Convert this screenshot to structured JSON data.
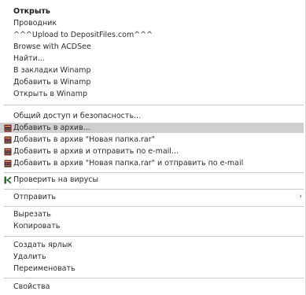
{
  "menu": {
    "open": "Открыть",
    "explorer": "Проводник",
    "upload": "^^^Upload to DepositFiles.com^^^",
    "browse_acdsee": "Browse with ACDSee",
    "find": "Найти...",
    "winamp_bookmarks": "В закладки Winamp",
    "winamp_add": "Добавить в Winamp",
    "winamp_open": "Открыть в Winamp",
    "sharing_security": "Общий доступ и безопасность...",
    "add_archive": "Добавить в архив...",
    "add_named_archive": "Добавить в архив \"Новая папка.rar\"",
    "add_archive_email": "Добавить в архив и отправить по e-mail...",
    "add_named_archive_email": "Добавить в архив \"Новая папка.rar\" и отправить по e-mail",
    "scan_viruses": "Проверить на вирусы",
    "send_to": "Отправить",
    "send_to_arrow": "›",
    "cut": "Вырезать",
    "copy": "Копировать",
    "create_shortcut": "Создать ярлык",
    "delete": "Удалить",
    "rename": "Переименовать",
    "properties": "Свойства"
  },
  "icons": {
    "archive": "winrar-archive-icon",
    "antivirus": "kaspersky-k-icon"
  },
  "colors": {
    "highlight": "#cfcfcf",
    "separator": "#c8c8c8",
    "archive_icon": "#7a1a1a",
    "antivirus_icon": "#2a6a2a"
  }
}
